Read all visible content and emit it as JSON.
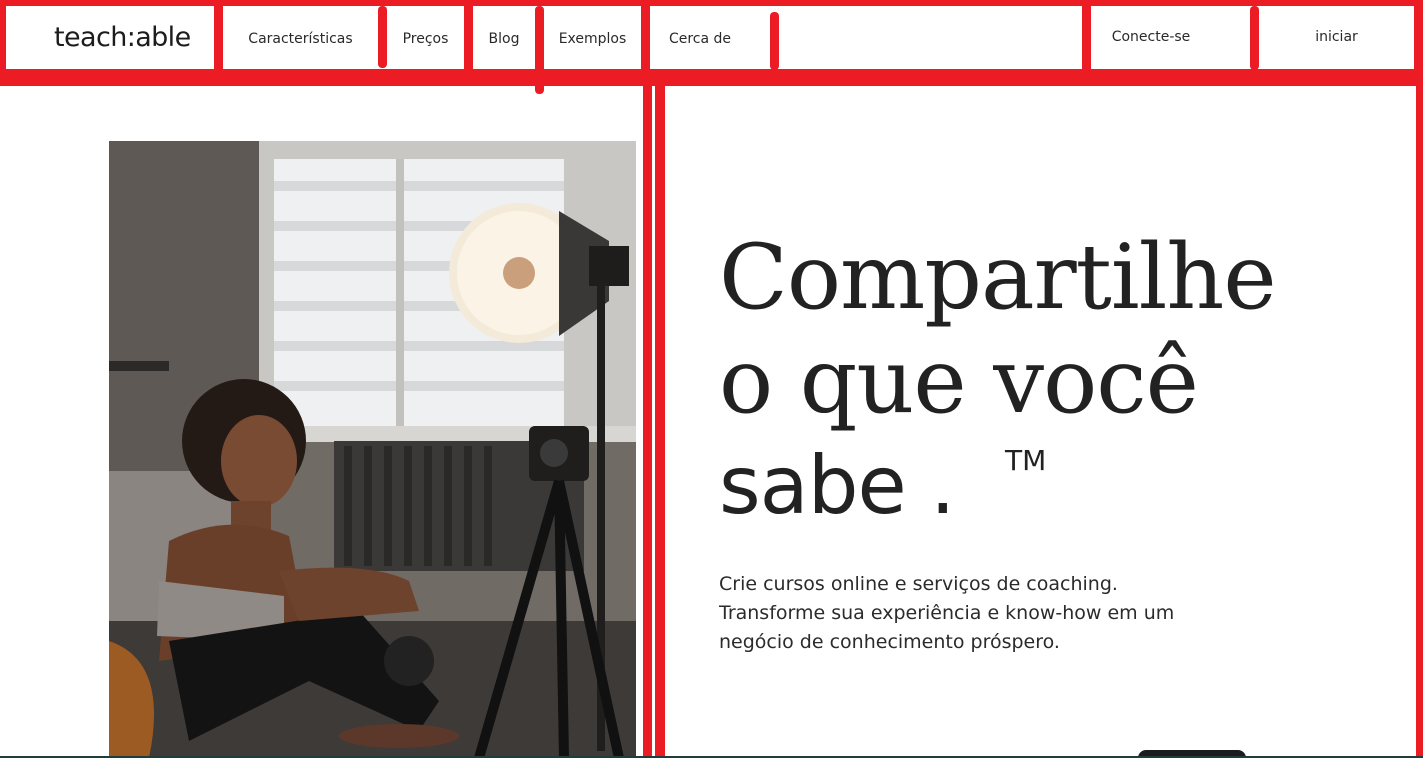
{
  "brand": {
    "logo_text": "teach:able"
  },
  "nav": {
    "items": [
      {
        "label": "Características"
      },
      {
        "label": "Preços"
      },
      {
        "label": "Blog"
      },
      {
        "label": "Exemplos"
      },
      {
        "label": "Cerca de"
      }
    ],
    "login_label": "Conecte-se",
    "start_label": "iniciar"
  },
  "hero": {
    "headline_line1": "Compartilhe",
    "headline_line2": "o que você",
    "headline_line3": "sabe .",
    "trademark": "TM",
    "subtitle_line1": "Crie cursos online e serviços de coaching.",
    "subtitle_line2": "Transforme sua experiência e know-how em um",
    "subtitle_line3": "negócio de conhecimento próspero.",
    "image_icon": "creator-filming-photo"
  },
  "colors": {
    "annotation_frame": "#ec1c24",
    "text": "#222222",
    "background": "#ffffff",
    "cta": "#1c1c1c"
  }
}
